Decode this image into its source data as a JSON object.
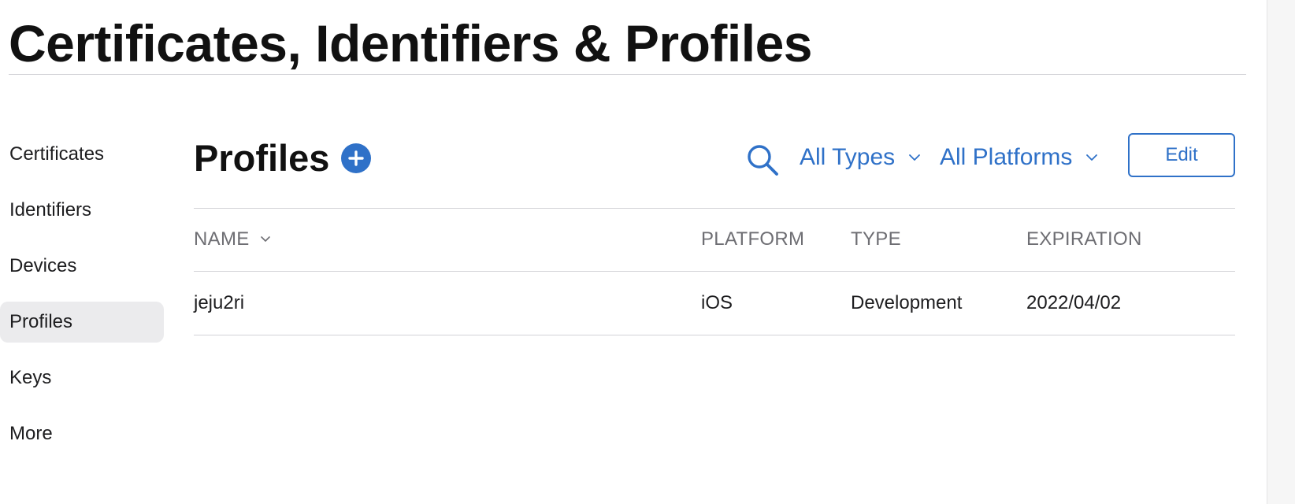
{
  "header": {
    "title": "Certificates, Identifiers & Profiles"
  },
  "sidebar": {
    "items": [
      {
        "label": "Certificates",
        "active": false
      },
      {
        "label": "Identifiers",
        "active": false
      },
      {
        "label": "Devices",
        "active": false
      },
      {
        "label": "Profiles",
        "active": true
      },
      {
        "label": "Keys",
        "active": false
      },
      {
        "label": "More",
        "active": false
      }
    ]
  },
  "main": {
    "section_title": "Profiles",
    "add_icon": "plus-circle-icon",
    "search_icon": "search-icon",
    "filters": {
      "types": "All Types",
      "platforms": "All Platforms"
    },
    "edit_label": "Edit"
  },
  "table": {
    "columns": [
      "NAME",
      "PLATFORM",
      "TYPE",
      "EXPIRATION"
    ],
    "rows": [
      [
        "jeju2ri",
        "iOS",
        "Development",
        "2022/04/02"
      ]
    ]
  },
  "colors": {
    "accent": "#2f71c8",
    "text": "#1d1d1f",
    "muted": "#6e6e73",
    "active_bg": "#ebebed",
    "divider": "#d2d2d7"
  }
}
